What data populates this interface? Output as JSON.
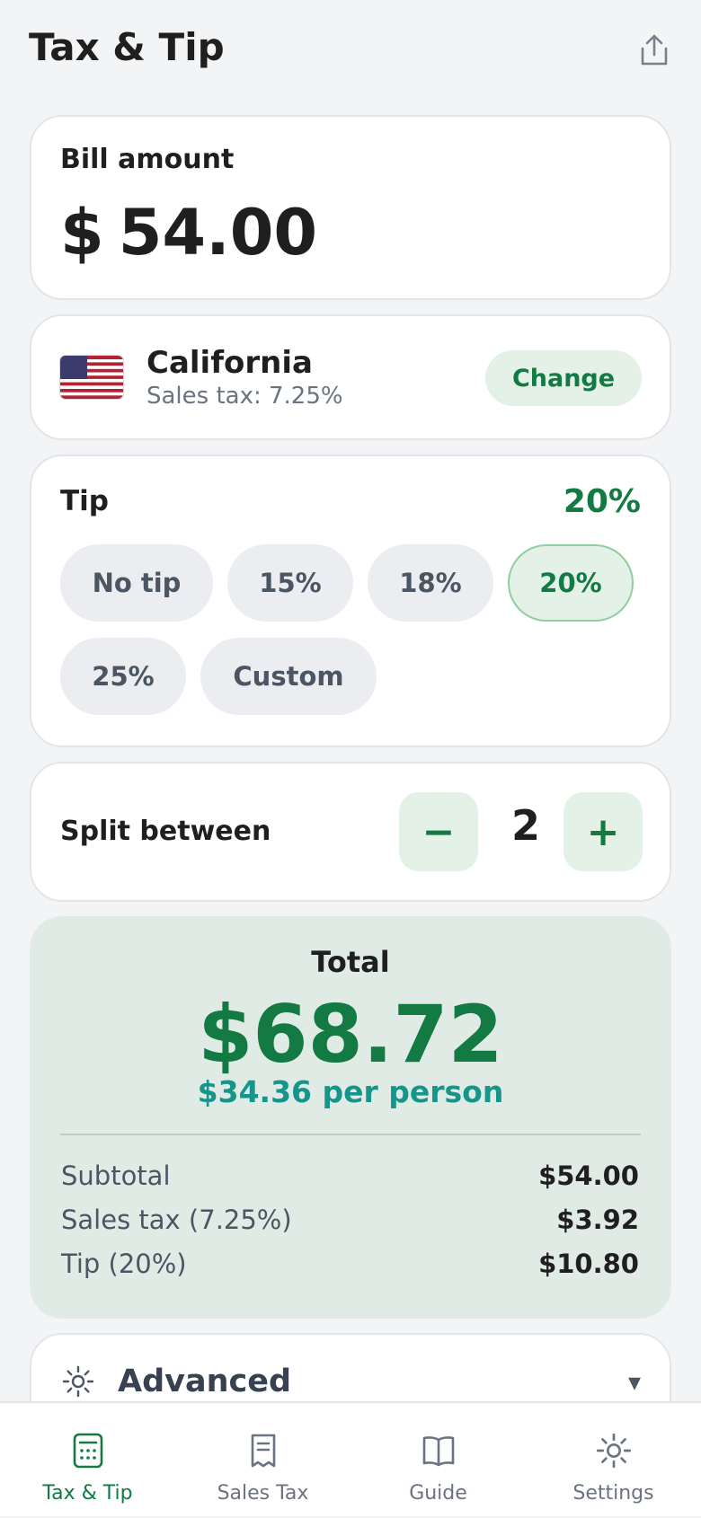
{
  "header": {
    "title": "Tax & Tip",
    "share_icon": "share-icon"
  },
  "bill": {
    "label": "Bill amount",
    "currency": "$",
    "amount": "54.00"
  },
  "region": {
    "flag_icon": "us-flag-icon",
    "name": "California",
    "tax_text": "Sales tax: 7.25%",
    "change_label": "Change"
  },
  "tip": {
    "label": "Tip",
    "current": "20%",
    "options": [
      "No tip",
      "15%",
      "18%",
      "20%",
      "25%",
      "Custom"
    ],
    "selected": "20%"
  },
  "split": {
    "label": "Split between",
    "count": "2",
    "minus": "−",
    "plus": "+"
  },
  "total": {
    "label": "Total",
    "amount": "$68.72",
    "per_person": "$34.36 per person",
    "lines": [
      {
        "label": "Subtotal",
        "value": "$54.00"
      },
      {
        "label": "Sales tax (7.25%)",
        "value": "$3.92"
      },
      {
        "label": "Tip (20%)",
        "value": "$10.80"
      }
    ]
  },
  "advanced": {
    "icon": "gear-icon",
    "label": "Advanced",
    "chevron": "▾"
  },
  "nav": {
    "items": [
      {
        "label": "Tax & Tip",
        "icon": "calculator-icon",
        "active": true
      },
      {
        "label": "Sales Tax",
        "icon": "receipt-icon",
        "active": false
      },
      {
        "label": "Guide",
        "icon": "book-icon",
        "active": false
      },
      {
        "label": "Settings",
        "icon": "gear-icon",
        "active": false
      }
    ]
  },
  "colors": {
    "accent": "#137a43",
    "accent_light": "#e3f1e7",
    "teal": "#16968a",
    "background": "#f3f4f6"
  }
}
